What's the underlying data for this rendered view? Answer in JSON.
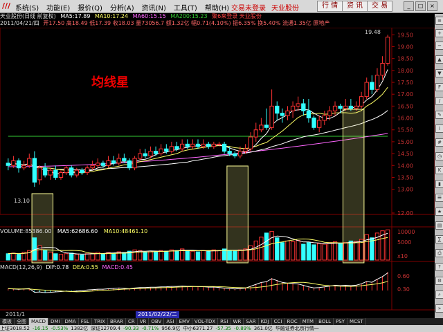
{
  "menubar": {
    "logo": "///",
    "menus": [
      "系统(S)",
      "功能(E)",
      "报价(Q)",
      "分析(A)",
      "资讯(N)",
      "工具(T)",
      "帮助(H)"
    ],
    "links": [
      "交易未登录",
      "天业股份"
    ],
    "buttons": [
      "行 情",
      "资 讯",
      "交 易"
    ]
  },
  "price_header": {
    "row1": {
      "name": "天业股份(日线 前复权)",
      "ma5": "MA5:17.89",
      "ma10": "MA10:17.24",
      "ma60": "MA60:15.15",
      "ma200": "MA200:15.23",
      "extra": "聚6来登录  天业股份"
    },
    "row2": {
      "date": "2011/04/21/四",
      "rest": "开17.50 高18.49 低17.39 收18.03 量73056.7 额1.32亿 幅0.71(4.10%) 振6.35% 换5.40% 流通1.35亿 原地产"
    },
    "colors": {
      "ma5": "#ffffff",
      "ma10": "#ffff66",
      "ma60": "#ff66ff",
      "ma200": "#33cc33",
      "up": "#ff3333",
      "down": "#33ffff"
    }
  },
  "annotation": {
    "title": "均线星",
    "low_label": "13.10",
    "high_label": "19.48"
  },
  "price_axis": [
    "19.50",
    "19.00",
    "18.50",
    "18.00",
    "17.50",
    "17.00",
    "16.50",
    "16.00",
    "15.50",
    "15.00",
    "14.50",
    "14.00",
    "13.50",
    "13.00",
    "12.00"
  ],
  "volume_header": {
    "volume": "VOLUME:85386.00",
    "ma5": "MA5:62686.60",
    "ma10": "MA10:48461.10"
  },
  "volume_axis": [
    "10000",
    "5000",
    "x10"
  ],
  "macd_header": {
    "name": "MACD(12,26,9)",
    "dif": "DIF:0.78",
    "dea": "DEA:0.55",
    "macd": "MACD:0.45"
  },
  "macd_axis": [
    "0.60",
    "0.30"
  ],
  "time_bar": {
    "left": "2011/1",
    "mid": "2011/02/22/二"
  },
  "tabs": [
    "模板",
    "全图",
    "MACD",
    "DMI",
    "DMA",
    "FSL",
    "TRIX",
    "BRAR",
    "CR",
    "VR",
    "OBV",
    "ASI",
    "EMV",
    "VOL-TDX",
    "RSI",
    "WR",
    "SAR",
    "KDJ",
    "CCI",
    "ROC",
    "MTM",
    "BOLL",
    "PSY",
    "MCST"
  ],
  "active_tab": "MACD",
  "status": [
    "上证3018.52",
    "-16.15",
    "-0.53%",
    "1382亿",
    "深证12709.4",
    "-90.33",
    "-0.71%",
    "956.9亿",
    "中小6371.27",
    "-57.35",
    "-0.89%",
    "361.0亿",
    "华融证券北京行情一"
  ],
  "chart_data": {
    "type": "candlestick",
    "title": "",
    "y_axis_ticks": [
      19.5,
      19.0,
      18.5,
      18.0,
      17.5,
      17.0,
      16.5,
      16.0,
      15.5,
      15.0,
      14.5,
      14.0,
      13.5,
      13.0,
      12.0
    ],
    "ylim": [
      12.0,
      19.8
    ],
    "annotations": [
      "13.10",
      "19.48"
    ],
    "candles": [
      [
        14.1,
        14.0,
        14.3,
        13.8
      ],
      [
        14.0,
        14.2,
        14.4,
        13.9
      ],
      [
        14.2,
        13.9,
        14.3,
        13.7
      ],
      [
        13.9,
        14.0,
        14.2,
        13.8
      ],
      [
        14.0,
        14.3,
        14.5,
        13.9
      ],
      [
        14.3,
        13.3,
        14.6,
        13.1
      ],
      [
        13.4,
        13.9,
        14.0,
        13.2
      ],
      [
        13.9,
        13.6,
        14.1,
        13.5
      ],
      [
        13.6,
        13.8,
        13.9,
        13.4
      ],
      [
        13.8,
        13.5,
        14.0,
        13.4
      ],
      [
        13.5,
        13.7,
        13.8,
        13.4
      ],
      [
        13.7,
        13.9,
        14.0,
        13.6
      ],
      [
        13.9,
        13.6,
        14.0,
        13.5
      ],
      [
        13.6,
        13.8,
        13.9,
        13.5
      ],
      [
        13.8,
        13.7,
        13.9,
        13.6
      ],
      [
        13.7,
        13.9,
        14.0,
        13.6
      ],
      [
        13.9,
        14.0,
        14.2,
        13.8
      ],
      [
        14.0,
        14.1,
        14.3,
        13.9
      ],
      [
        14.1,
        14.0,
        14.2,
        13.9
      ],
      [
        14.0,
        14.2,
        14.4,
        13.9
      ],
      [
        14.2,
        14.1,
        14.4,
        14.0
      ],
      [
        14.1,
        14.3,
        14.5,
        14.0
      ],
      [
        14.3,
        14.2,
        14.5,
        14.1
      ],
      [
        14.2,
        13.9,
        14.3,
        13.8
      ],
      [
        13.9,
        14.3,
        14.4,
        13.8
      ],
      [
        14.3,
        14.5,
        14.7,
        14.2
      ],
      [
        14.5,
        14.4,
        14.7,
        14.3
      ],
      [
        14.4,
        14.6,
        14.8,
        14.3
      ],
      [
        14.6,
        14.5,
        14.8,
        14.4
      ],
      [
        14.5,
        14.7,
        14.9,
        14.4
      ],
      [
        14.7,
        14.6,
        14.9,
        14.5
      ],
      [
        14.6,
        14.8,
        15.0,
        14.5
      ],
      [
        14.8,
        14.7,
        15.0,
        14.6
      ],
      [
        14.7,
        14.9,
        15.1,
        14.6
      ],
      [
        14.9,
        14.8,
        15.1,
        14.7
      ],
      [
        14.8,
        14.9,
        15.1,
        14.7
      ],
      [
        14.9,
        14.8,
        15.1,
        14.7
      ],
      [
        14.8,
        14.9,
        15.1,
        14.7
      ],
      [
        14.9,
        14.8,
        15.0,
        14.7
      ],
      [
        14.8,
        14.9,
        15.0,
        14.7
      ],
      [
        14.9,
        14.9,
        15.0,
        14.8
      ],
      [
        14.9,
        14.6,
        15.0,
        14.5
      ],
      [
        14.6,
        14.5,
        14.8,
        14.4
      ],
      [
        14.5,
        14.4,
        14.6,
        14.3
      ],
      [
        14.4,
        14.6,
        14.8,
        14.3
      ],
      [
        14.6,
        14.7,
        14.9,
        14.5
      ],
      [
        14.7,
        15.2,
        15.4,
        14.6
      ],
      [
        15.2,
        15.5,
        15.8,
        15.0
      ],
      [
        15.5,
        15.7,
        16.0,
        15.4
      ],
      [
        15.7,
        15.6,
        16.4,
        15.5
      ],
      [
        15.6,
        16.5,
        17.2,
        15.5
      ],
      [
        16.5,
        16.2,
        16.7,
        15.9
      ],
      [
        16.2,
        16.1,
        16.4,
        15.8
      ],
      [
        16.1,
        16.3,
        16.5,
        15.9
      ],
      [
        16.3,
        16.5,
        16.7,
        16.0
      ],
      [
        16.5,
        16.6,
        16.9,
        16.3
      ],
      [
        16.6,
        16.3,
        16.8,
        16.1
      ],
      [
        16.3,
        16.0,
        16.8,
        15.8
      ],
      [
        16.0,
        15.6,
        16.1,
        15.5
      ],
      [
        15.6,
        15.9,
        16.1,
        15.4
      ],
      [
        15.9,
        16.1,
        16.3,
        15.7
      ],
      [
        16.1,
        16.3,
        16.5,
        15.9
      ],
      [
        16.3,
        16.5,
        16.7,
        16.1
      ],
      [
        16.5,
        16.4,
        16.6,
        16.2
      ],
      [
        16.4,
        16.5,
        16.8,
        16.3
      ],
      [
        16.5,
        16.4,
        16.8,
        16.3
      ],
      [
        16.4,
        16.5,
        16.7,
        16.3
      ],
      [
        16.5,
        16.9,
        17.1,
        16.4
      ],
      [
        16.9,
        17.5,
        17.7,
        16.8
      ],
      [
        17.5,
        17.2,
        17.8,
        17.0
      ],
      [
        17.2,
        17.8,
        18.1,
        17.1
      ],
      [
        17.8,
        18.3,
        18.6,
        17.6
      ],
      [
        18.3,
        19.4,
        19.5,
        18.2
      ]
    ],
    "volume": [
      20,
      22,
      18,
      25,
      30,
      70,
      45,
      30,
      25,
      20,
      18,
      20,
      22,
      18,
      16,
      20,
      22,
      25,
      20,
      24,
      22,
      26,
      24,
      28,
      32,
      30,
      25,
      28,
      26,
      30,
      28,
      32,
      30,
      35,
      30,
      28,
      26,
      30,
      28,
      32,
      30,
      35,
      30,
      28,
      32,
      35,
      45,
      60,
      72,
      85,
      90,
      70,
      55,
      60,
      58,
      62,
      50,
      55,
      48,
      52,
      50,
      55,
      58,
      52,
      55,
      60,
      58,
      65,
      80,
      70,
      85,
      92,
      95
    ],
    "macd": [
      0.05,
      0.04,
      0.03,
      0.04,
      0.05,
      -0.05,
      -0.04,
      -0.06,
      -0.05,
      -0.04,
      -0.03,
      -0.02,
      -0.03,
      -0.02,
      -0.01,
      0.01,
      0.02,
      0.03,
      0.03,
      0.04,
      0.05,
      0.06,
      0.05,
      0.04,
      0.06,
      0.07,
      0.07,
      0.08,
      0.08,
      0.09,
      0.09,
      0.1,
      0.1,
      0.11,
      0.1,
      0.1,
      0.09,
      0.09,
      0.08,
      0.08,
      0.07,
      0.05,
      0.04,
      0.03,
      0.04,
      0.05,
      0.1,
      0.15,
      0.2,
      0.22,
      0.3,
      0.25,
      0.2,
      0.18,
      0.17,
      0.16,
      0.12,
      0.08,
      0.05,
      0.06,
      0.08,
      0.1,
      0.12,
      0.11,
      0.12,
      0.11,
      0.12,
      0.16,
      0.22,
      0.2,
      0.28,
      0.35,
      0.45
    ]
  }
}
